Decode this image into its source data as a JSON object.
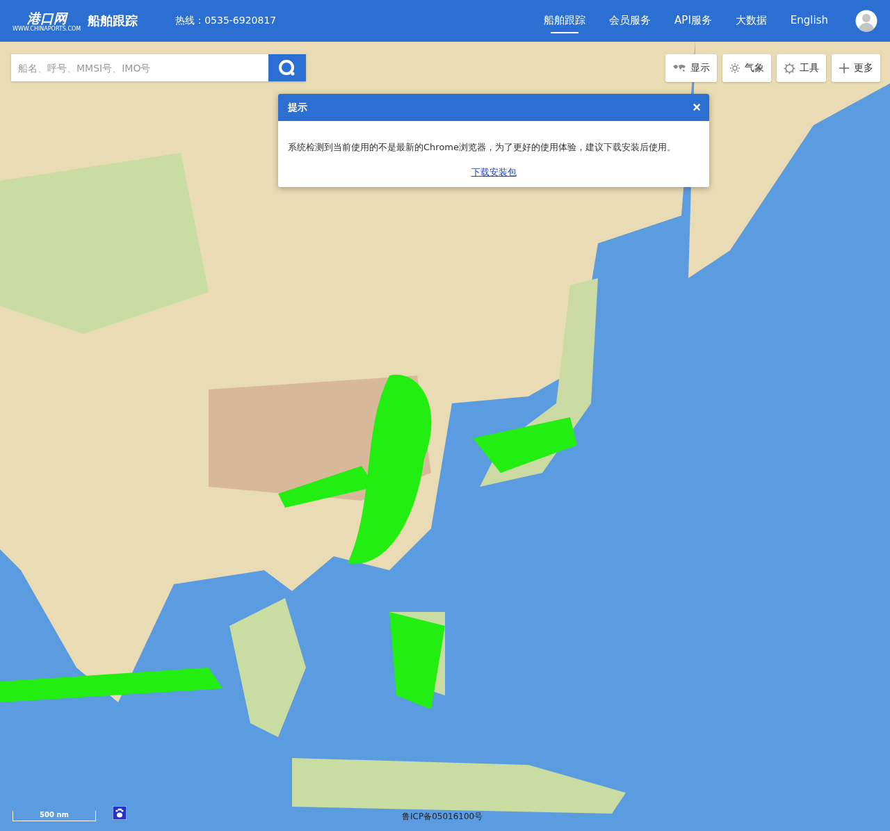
{
  "header": {
    "logo": {
      "name": "港口网",
      "site": "WWW.CHINAPORTS.COM",
      "product": "船舶跟踪"
    },
    "hotline": "热线：0535-6920817",
    "nav": [
      {
        "label": "船舶跟踪",
        "selected": true
      },
      {
        "label": "会员服务",
        "selected": false
      },
      {
        "label": "API服务",
        "selected": false
      },
      {
        "label": "大数据",
        "selected": false
      },
      {
        "label": "English",
        "selected": false
      }
    ]
  },
  "search": {
    "placeholder": "船名、呼号、MMSI号、IMO号"
  },
  "tools": [
    {
      "label": "显示",
      "kind": "map"
    },
    {
      "label": "气象",
      "kind": "weather"
    },
    {
      "label": "工具",
      "kind": "gear"
    },
    {
      "label": "更多",
      "kind": "plus"
    }
  ],
  "dialog": {
    "title": "提示",
    "close": "×",
    "message": "系统检测到当前使用的不是最新的Chrome浏览器，为了更好的使用体验，建议下载安装后使用。",
    "link": "下载安装包"
  },
  "map": {
    "scale": "500 nm",
    "icp": "鲁ICP备05016100号"
  }
}
